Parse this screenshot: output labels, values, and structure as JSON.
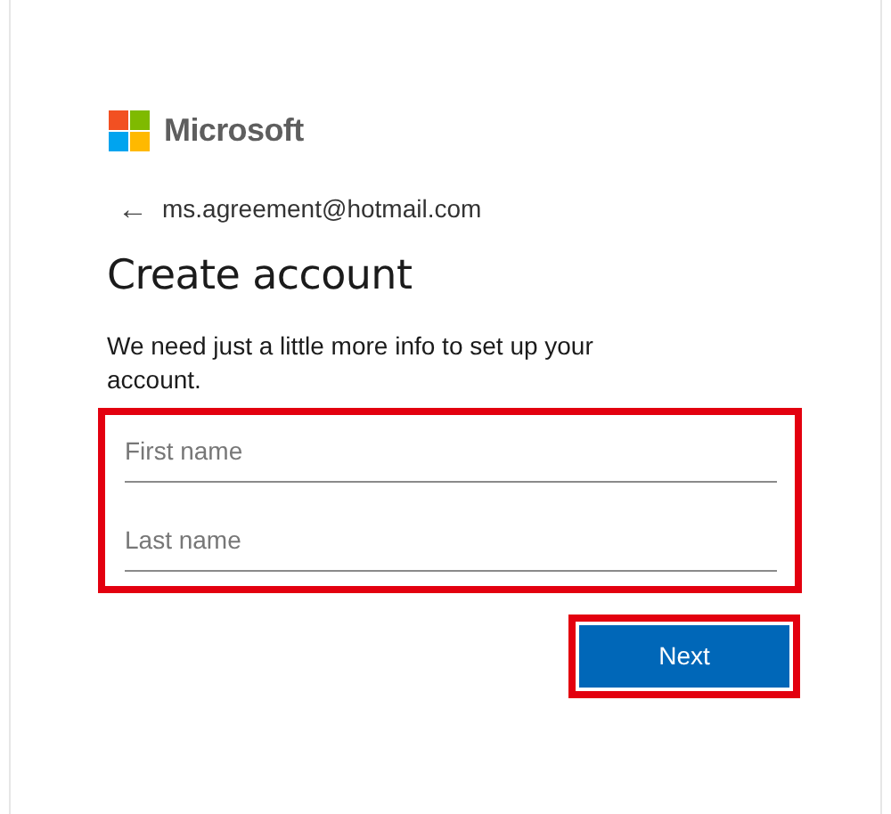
{
  "brand": {
    "name": "Microsoft"
  },
  "back": {
    "arrow": "←",
    "email": "ms.agreement@hotmail.com"
  },
  "title": "Create account",
  "description": "We need just a little more info to set up your account.",
  "fields_group": {
    "highlighted": true,
    "fields": [
      {
        "placeholder": "First name"
      },
      {
        "placeholder": "Last name"
      }
    ]
  },
  "next_button": {
    "label": "Next",
    "highlighted": true
  }
}
